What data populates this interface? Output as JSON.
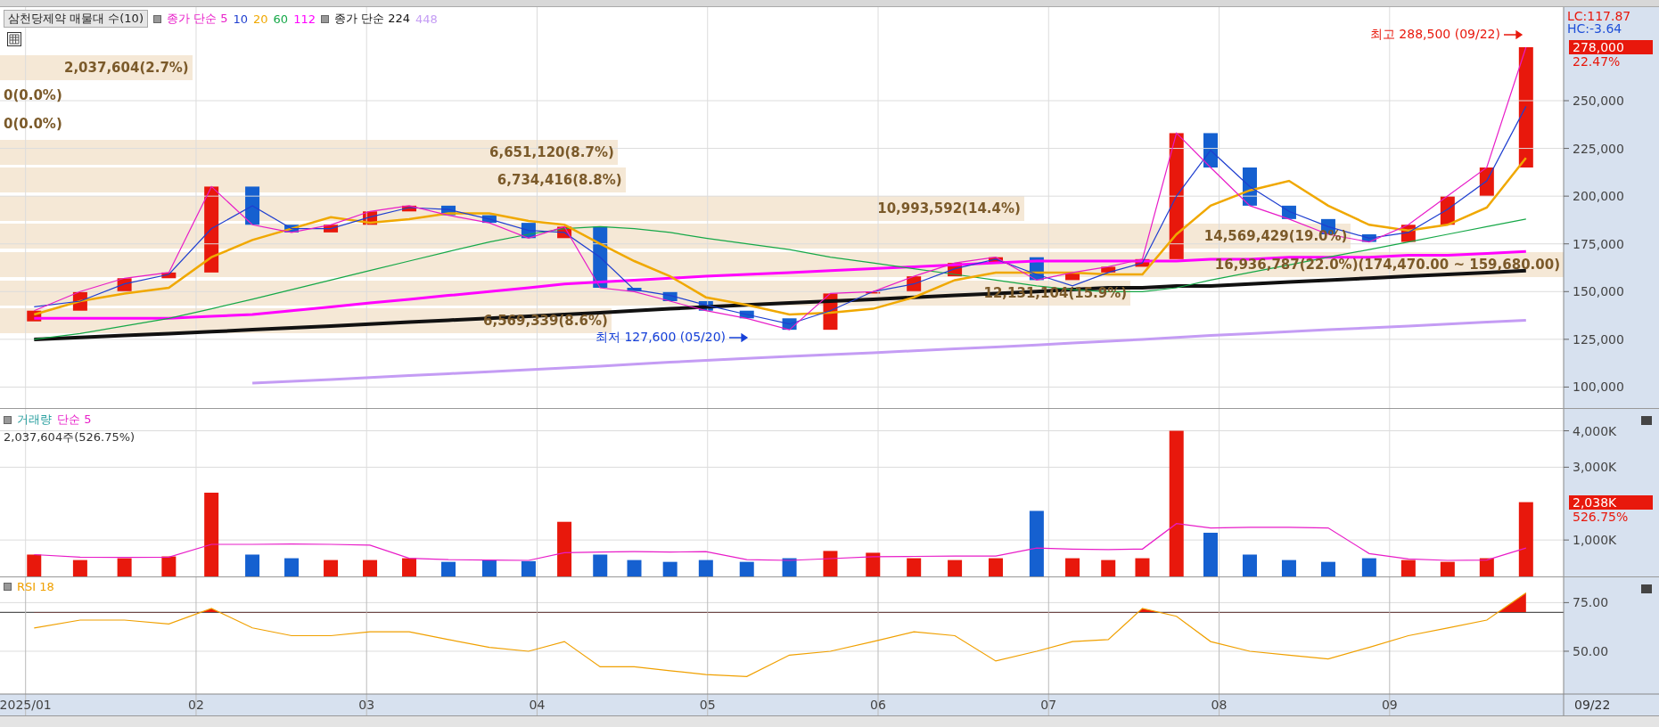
{
  "price_panel": {
    "title": "삼천당제약 매물대 수(10)",
    "legend": [
      {
        "label": "종가 단순 5",
        "color": "#e81cc8",
        "bullet": true
      },
      {
        "label": "10",
        "color": "#1f3fd0",
        "bullet": false
      },
      {
        "label": "20",
        "color": "#f0a800",
        "bullet": false
      },
      {
        "label": "60",
        "color": "#16a848",
        "bullet": false
      },
      {
        "label": "112",
        "color": "#ff00ff",
        "bullet": false
      },
      {
        "label": "종가 단순 224",
        "color": "#111111",
        "bullet": true
      },
      {
        "label": "448",
        "color": "#c49cf4",
        "bullet": false
      }
    ],
    "volume_bands": [
      {
        "label": "2,037,604(2.7%)",
        "level": 0.123
      },
      {
        "label": "0(0.0%)"
      },
      {
        "label": "0(0.0%)"
      },
      {
        "label": "6,651,120(8.7%)",
        "level": 0.395
      },
      {
        "label": "6,734,416(8.8%)",
        "level": 0.4
      },
      {
        "label": "10,993,592(14.4%)",
        "level": 0.655
      },
      {
        "label": "14,569,429(19.0%)",
        "level": 0.864
      },
      {
        "label": "16,936,787(22.0%)(174,470.00 ~ 159,680.00)",
        "kind": "max"
      },
      {
        "label": "12,131,104(15.9%)",
        "level": 0.723
      },
      {
        "label": "6,569,339(8.6%)",
        "level": 0.391
      }
    ],
    "high_marker": {
      "text": "최고 288,500 (09/22)"
    },
    "low_marker": {
      "text": "최저 127,600 (05/20)"
    },
    "axis": {
      "lc": "LC:117.87",
      "hc": "HC:-3.64",
      "price_tag": "278,000",
      "change": "22.47%"
    },
    "chart_data": {
      "type": "line",
      "grid": true,
      "x": [
        1.05,
        1.32,
        1.58,
        1.84,
        2.09,
        2.33,
        2.56,
        2.79,
        3.02,
        3.25,
        3.48,
        3.72,
        3.95,
        4.16,
        4.37,
        4.57,
        4.78,
        4.99,
        5.23,
        5.48,
        5.72,
        5.97,
        6.21,
        6.45,
        6.69,
        6.93,
        7.14,
        7.35,
        7.55,
        7.75,
        7.95,
        8.18,
        8.41,
        8.64,
        8.88,
        9.11,
        9.34,
        9.57,
        9.8
      ],
      "xlim": [
        0.85,
        10.58
      ],
      "ylim": [
        89000,
        299000
      ],
      "yticks": [
        {
          "value": 100000,
          "label": "100,000"
        },
        {
          "value": 125000,
          "label": "125,000"
        },
        {
          "value": 150000,
          "label": "150,000"
        },
        {
          "value": 175000,
          "label": "175,000"
        },
        {
          "value": 200000,
          "label": "200,000"
        },
        {
          "value": 225000,
          "label": "225,000"
        },
        {
          "value": 250000,
          "label": "250,000"
        }
      ],
      "series": [
        {
          "color": "#c49cf4",
          "values": [
            null,
            null,
            null,
            null,
            null,
            102000,
            103000,
            104000,
            105000,
            106000,
            107000,
            108000,
            109000,
            110000,
            111000,
            112000,
            113000,
            114000,
            115000,
            116000,
            117000,
            118000,
            119000,
            120000,
            121000,
            122000,
            123000,
            124000,
            125000,
            126000,
            127000,
            128000,
            129000,
            130000,
            131000,
            132000,
            133000,
            134000,
            135000
          ]
        },
        {
          "color": "#111111",
          "values": [
            125000,
            126000,
            127000,
            128000,
            129000,
            130000,
            131000,
            132000,
            133000,
            134000,
            135000,
            136000,
            137000,
            138000,
            139000,
            140000,
            141000,
            142000,
            143000,
            144000,
            145000,
            146000,
            147000,
            148000,
            149000,
            150000,
            151000,
            152000,
            152000,
            153000,
            153000,
            154000,
            155000,
            156000,
            157000,
            158000,
            159000,
            160000,
            161000
          ]
        },
        {
          "color": "#ff00ff",
          "values": [
            136000,
            136000,
            136000,
            136000,
            137000,
            138000,
            140000,
            142000,
            144000,
            146000,
            148000,
            150000,
            152000,
            154000,
            155000,
            156000,
            157000,
            158000,
            159000,
            160000,
            161000,
            162000,
            163000,
            164000,
            165000,
            166000,
            166000,
            166000,
            166000,
            166000,
            167000,
            167000,
            168000,
            168000,
            168000,
            169000,
            169000,
            170000,
            171000
          ]
        },
        {
          "color": "#16a848",
          "values": [
            125000,
            128000,
            132000,
            136000,
            141000,
            146000,
            151000,
            156000,
            161000,
            166000,
            171000,
            176000,
            180000,
            183000,
            184000,
            183000,
            181000,
            178000,
            175000,
            172000,
            168000,
            165000,
            162000,
            159000,
            156000,
            153000,
            151000,
            150000,
            150000,
            152000,
            156000,
            160000,
            164000,
            168000,
            172000,
            176000,
            180000,
            184000,
            188000
          ]
        },
        {
          "color": "#f0a800",
          "values": [
            138000,
            145000,
            149000,
            152000,
            168000,
            177000,
            183000,
            189000,
            186000,
            188000,
            191000,
            191000,
            187000,
            185000,
            175000,
            166000,
            158000,
            147000,
            143000,
            138000,
            139000,
            141000,
            147000,
            156000,
            160000,
            160000,
            160000,
            159000,
            159000,
            180000,
            195000,
            203000,
            208000,
            195000,
            185000,
            182000,
            185000,
            194000,
            220000
          ]
        },
        {
          "color": "#1f3fd0",
          "values": [
            142000,
            145000,
            154000,
            159000,
            183000,
            195000,
            183000,
            183000,
            189000,
            194000,
            193000,
            188000,
            182000,
            181000,
            168000,
            151000,
            148000,
            143000,
            138000,
            133000,
            140000,
            150000,
            154000,
            162000,
            167000,
            159000,
            153000,
            160000,
            165000,
            200000,
            224000,
            205000,
            192000,
            184000,
            178000,
            181000,
            193000,
            208000,
            247000
          ]
        },
        {
          "color": "#e81cc8",
          "values": [
            140000,
            150000,
            157000,
            160000,
            205000,
            185000,
            181000,
            185000,
            192000,
            195000,
            190000,
            186000,
            178000,
            184000,
            152000,
            150000,
            145000,
            140000,
            136000,
            130000,
            149000,
            150000,
            158000,
            165000,
            168000,
            156000,
            160000,
            163000,
            167000,
            233000,
            215000,
            195000,
            188000,
            180000,
            176000,
            185000,
            200000,
            215000,
            278000
          ]
        }
      ]
    }
  },
  "volume_panel": {
    "title": "거래량",
    "ma_label": "단순 5",
    "reading": "2,037,604주(526.75%)",
    "axis": {
      "tag": "2,038K",
      "change": "526.75%"
    },
    "chart_data": {
      "type": "bar",
      "grid": true,
      "x": [
        1.05,
        1.32,
        1.58,
        1.84,
        2.09,
        2.33,
        2.56,
        2.79,
        3.02,
        3.25,
        3.48,
        3.72,
        3.95,
        4.16,
        4.37,
        4.57,
        4.78,
        4.99,
        5.23,
        5.48,
        5.72,
        5.97,
        6.21,
        6.45,
        6.69,
        6.93,
        7.14,
        7.35,
        7.55,
        7.75,
        7.95,
        8.18,
        8.41,
        8.64,
        8.88,
        9.11,
        9.34,
        9.57,
        9.8
      ],
      "xlim": [
        0.85,
        10.58
      ],
      "ylim": [
        0,
        4600000
      ],
      "yticks": [
        {
          "value": 1000000,
          "label": "1,000K"
        },
        {
          "value": 3000000,
          "label": "3,000K"
        },
        {
          "value": 4000000,
          "label": "4,000K"
        }
      ],
      "series": [
        {
          "color": "#e8180c",
          "values": [
            600000,
            450000,
            500000,
            550000,
            2300000,
            null,
            null,
            450000,
            450000,
            500000,
            null,
            null,
            null,
            1500000,
            null,
            null,
            null,
            null,
            null,
            null,
            700000,
            650000,
            500000,
            450000,
            500000,
            null,
            500000,
            450000,
            500000,
            4000000,
            null,
            null,
            null,
            null,
            null,
            450000,
            400000,
            500000,
            2040000
          ]
        },
        {
          "color": "#1560d0",
          "values": [
            null,
            null,
            null,
            null,
            null,
            600000,
            500000,
            null,
            null,
            null,
            400000,
            450000,
            420000,
            null,
            600000,
            450000,
            400000,
            450000,
            400000,
            500000,
            null,
            null,
            null,
            null,
            null,
            1800000,
            null,
            null,
            null,
            null,
            1200000,
            600000,
            450000,
            400000,
            500000,
            null,
            null,
            null,
            null
          ]
        },
        {
          "type": "line",
          "color": "#e81cc8",
          "values": [
            600000,
            530000,
            520000,
            530000,
            880000,
            880000,
            890000,
            880000,
            860000,
            500000,
            460000,
            450000,
            440000,
            650000,
            670000,
            680000,
            670000,
            680000,
            460000,
            440000,
            490000,
            540000,
            550000,
            560000,
            560000,
            780000,
            750000,
            740000,
            750000,
            1450000,
            1330000,
            1350000,
            1350000,
            1330000,
            630000,
            480000,
            440000,
            450000,
            780000
          ]
        }
      ]
    }
  },
  "rsi_panel": {
    "title": "RSI 18",
    "chart_data": {
      "type": "line",
      "grid": true,
      "x": [
        1.05,
        1.32,
        1.58,
        1.84,
        2.09,
        2.33,
        2.56,
        2.79,
        3.02,
        3.25,
        3.48,
        3.72,
        3.95,
        4.16,
        4.37,
        4.57,
        4.78,
        4.99,
        5.23,
        5.48,
        5.72,
        5.97,
        6.21,
        6.45,
        6.69,
        6.93,
        7.14,
        7.35,
        7.55,
        7.75,
        7.95,
        8.18,
        8.41,
        8.64,
        8.88,
        9.11,
        9.34,
        9.57,
        9.8
      ],
      "xlim": [
        0.85,
        10.58
      ],
      "ylim": [
        28,
        88
      ],
      "xticks": [
        {
          "value": 1,
          "label": "2025/01"
        },
        {
          "value": 2,
          "label": "02"
        },
        {
          "value": 3,
          "label": "03"
        },
        {
          "value": 4,
          "label": "04"
        },
        {
          "value": 5,
          "label": "05"
        },
        {
          "value": 6,
          "label": "06"
        },
        {
          "value": 7,
          "label": "07"
        },
        {
          "value": 8,
          "label": "08"
        },
        {
          "value": 9,
          "label": "09"
        }
      ],
      "yticks": [
        {
          "value": 50,
          "label": "50.00"
        },
        {
          "value": 75,
          "label": "75.00"
        }
      ],
      "series": [
        {
          "color": "#f0a000",
          "values": [
            62,
            66,
            66,
            64,
            72,
            62,
            58,
            58,
            60,
            60,
            56,
            52,
            50,
            55,
            42,
            42,
            40,
            38,
            37,
            48,
            50,
            55,
            60,
            58,
            45,
            50,
            55,
            56,
            72,
            68,
            55,
            50,
            48,
            46,
            52,
            58,
            62,
            66,
            80
          ]
        }
      ]
    }
  },
  "time_axis": {
    "date": "09/22"
  }
}
